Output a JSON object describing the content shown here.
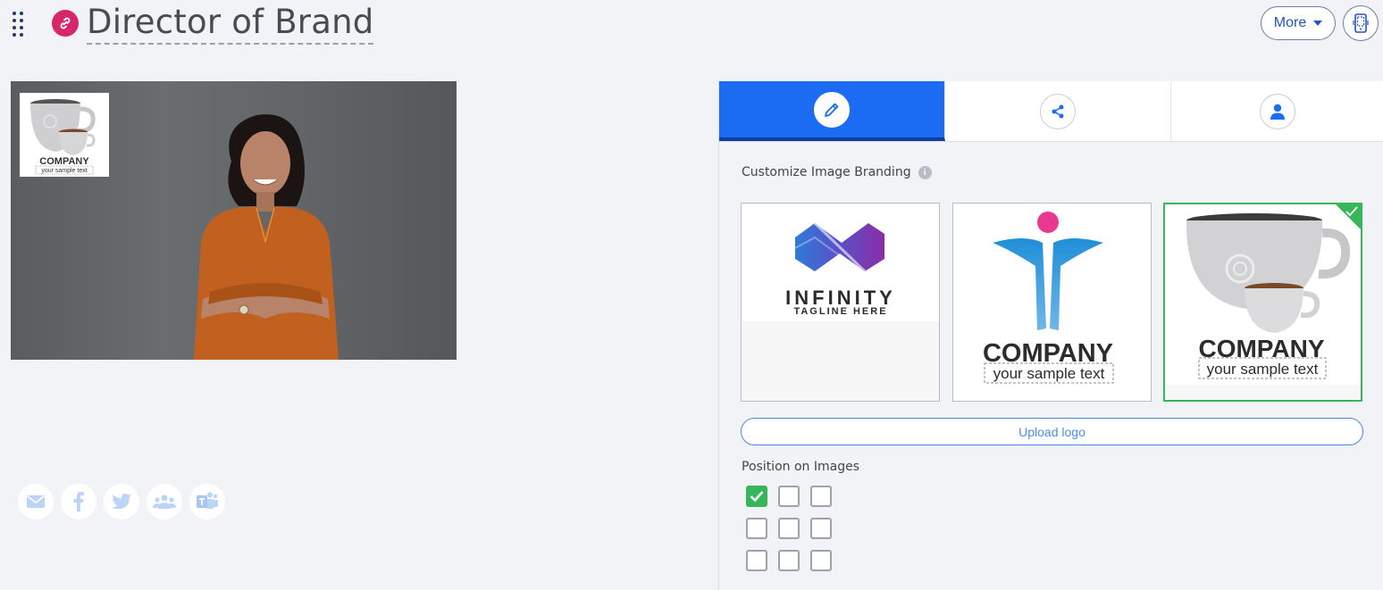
{
  "header": {
    "title": "Director of Brand",
    "more_label": "More"
  },
  "preview": {
    "overlay_logo": {
      "company": "COMPANY",
      "tagline": "your sample text"
    }
  },
  "share": {
    "icons": [
      "email-icon",
      "facebook-icon",
      "twitter-icon",
      "group-icon",
      "teams-icon"
    ],
    "color": "#bcd4f6"
  },
  "panel": {
    "tabs": [
      {
        "icon": "pencil-icon",
        "active": true
      },
      {
        "icon": "share-icon",
        "active": false
      },
      {
        "icon": "user-icon",
        "active": false
      }
    ],
    "branding_label": "Customize Image Branding",
    "logos": [
      {
        "name": "INFINITY",
        "tagline": "TAGLINE HERE",
        "selected": false
      },
      {
        "name": "COMPANY",
        "tagline": "your sample text",
        "selected": false
      },
      {
        "name": "COMPANY",
        "tagline": "your sample text",
        "selected": true
      }
    ],
    "upload_label": "Upload logo",
    "position_label": "Position on Images",
    "positions": [
      true,
      false,
      false,
      false,
      false,
      false,
      false,
      false,
      false
    ]
  },
  "colors": {
    "accent": "#1b6cf2",
    "selected_green": "#37b75a",
    "link_badge": "#d6276b"
  }
}
